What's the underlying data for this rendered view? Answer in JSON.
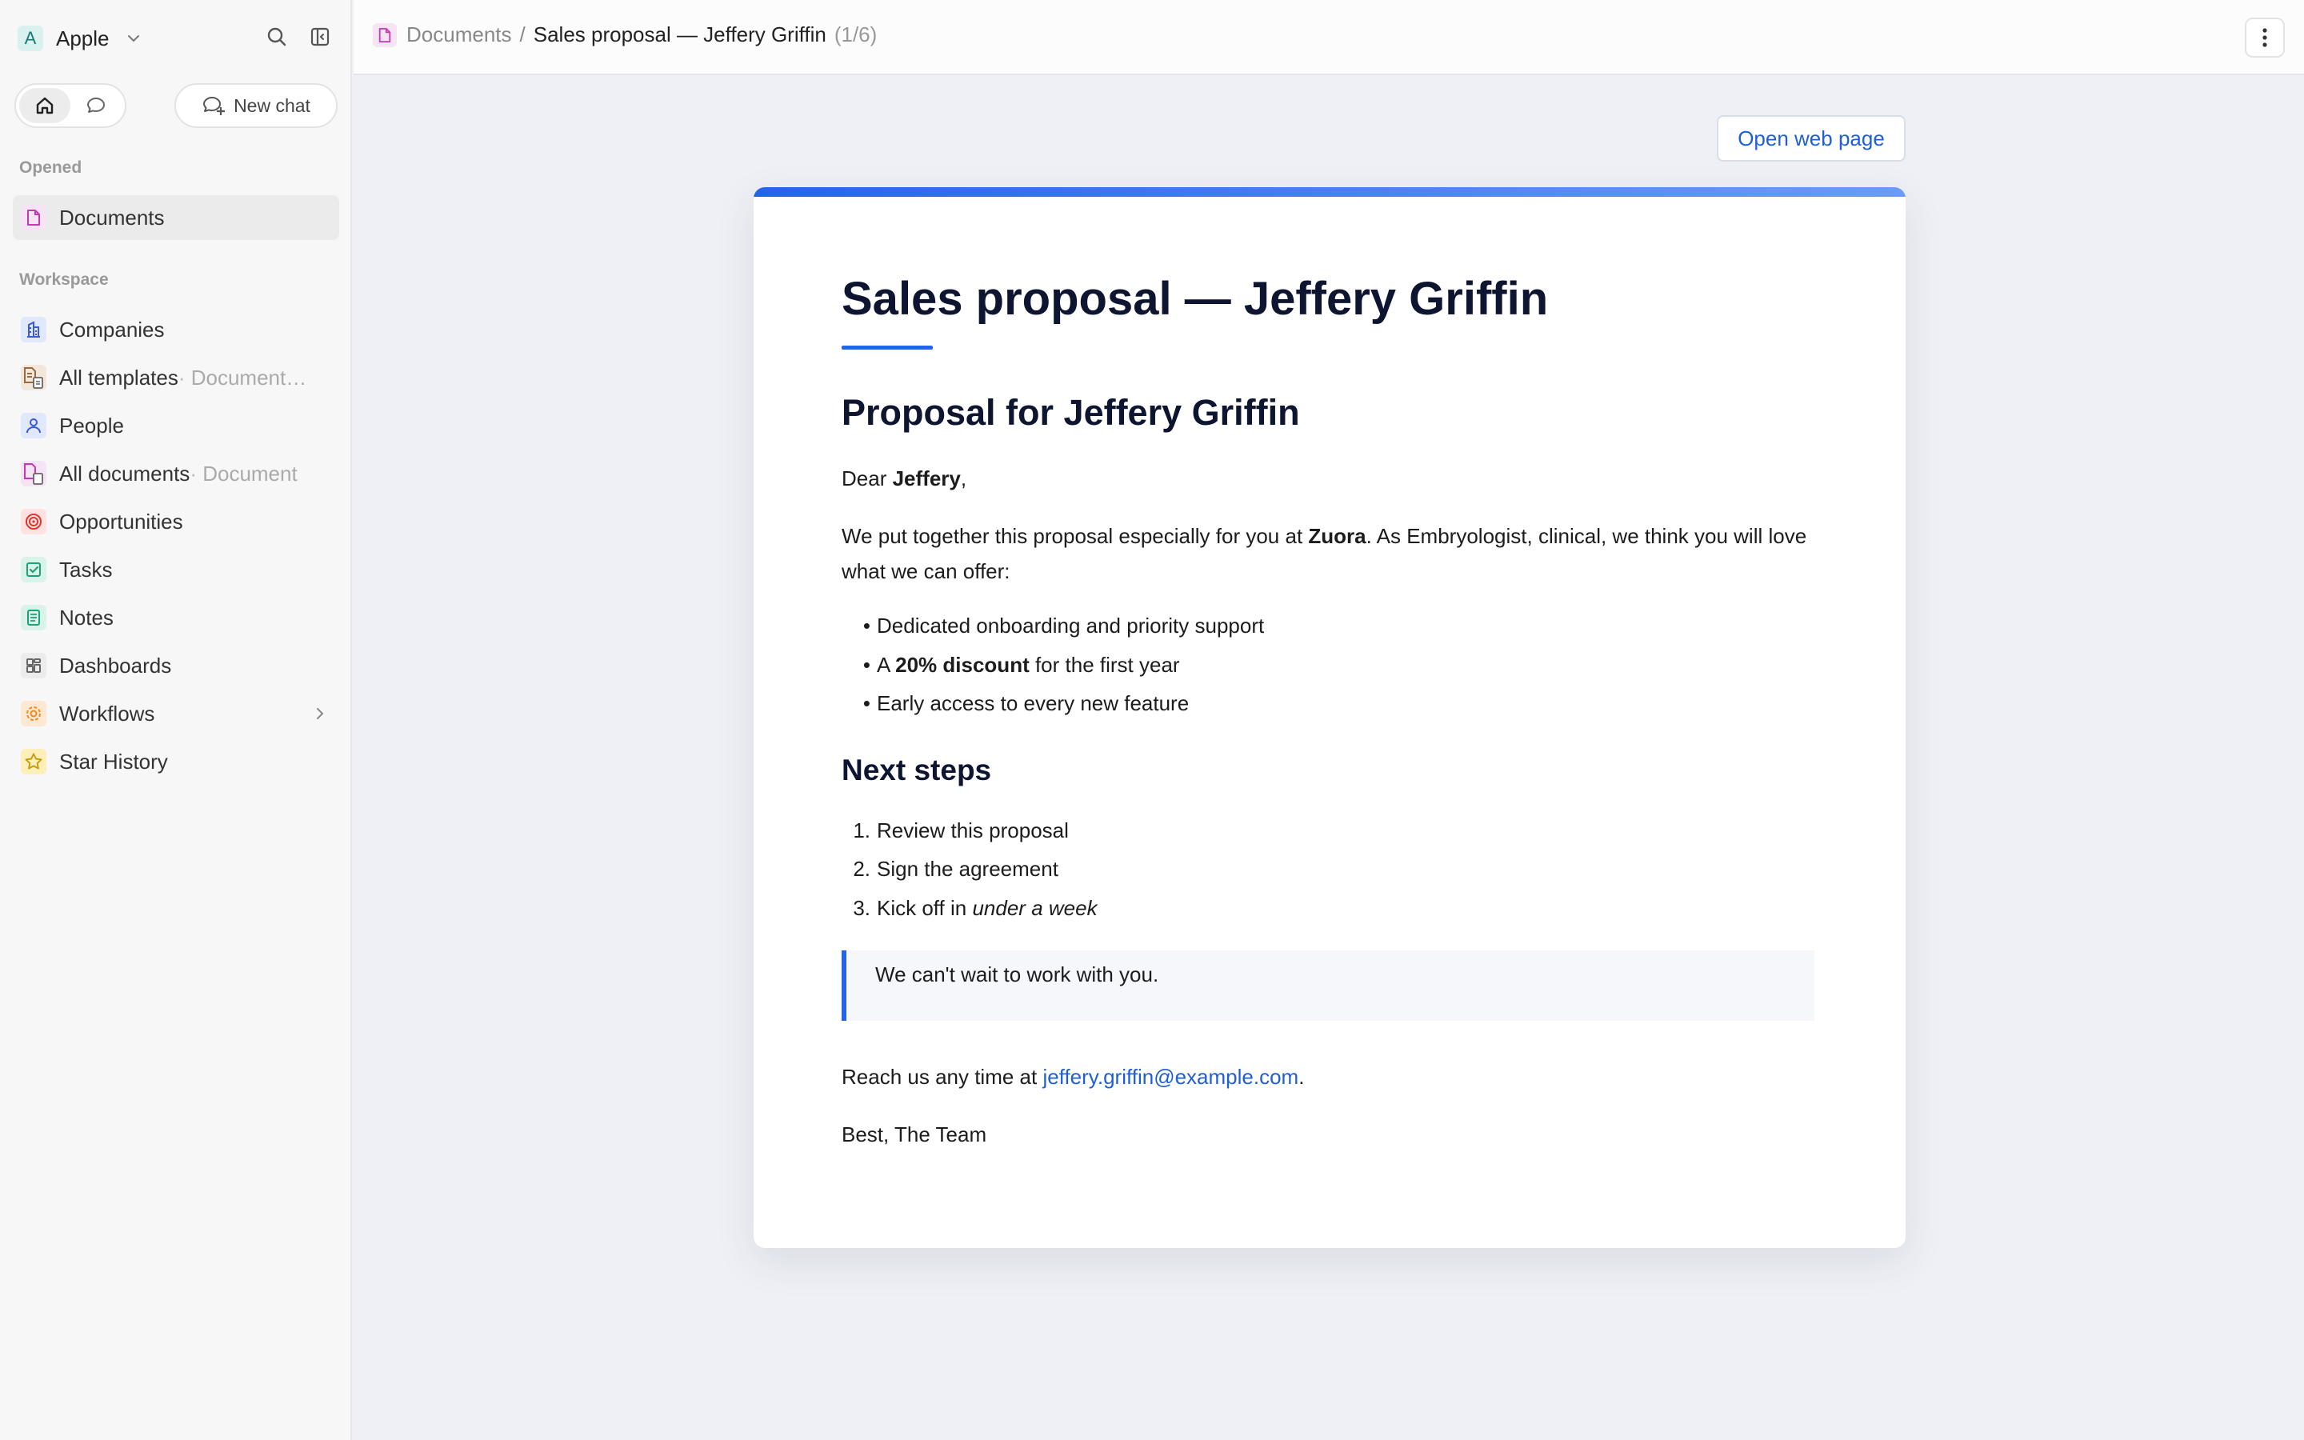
{
  "workspace": {
    "avatar_letter": "A",
    "name": "Apple"
  },
  "sidebar": {
    "new_chat_label": "New chat",
    "opened_label": "Opened",
    "opened_items": [
      {
        "label": "Documents",
        "icon": "document-icon",
        "color": "#c13bb5"
      }
    ],
    "workspace_label": "Workspace",
    "items": [
      {
        "label": "Companies",
        "icon": "building-icon",
        "color": "#3a5bd9"
      },
      {
        "label": "All templates",
        "sub": "Document t...",
        "icon": "templates-icon",
        "color": "#9a6a44"
      },
      {
        "label": "People",
        "icon": "person-icon",
        "color": "#3a5bd9"
      },
      {
        "label": "All documents",
        "sub": "Document",
        "icon": "documents-icon",
        "color": "#c13bb5"
      },
      {
        "label": "Opportunities",
        "icon": "target-icon",
        "color": "#e0362e"
      },
      {
        "label": "Tasks",
        "icon": "checkbox-icon",
        "color": "#1aa37a"
      },
      {
        "label": "Notes",
        "icon": "note-icon",
        "color": "#1aa37a"
      },
      {
        "label": "Dashboards",
        "icon": "dashboard-icon",
        "color": "#666666"
      },
      {
        "label": "Workflows",
        "icon": "gear-icon",
        "color": "#f08a1d"
      },
      {
        "label": "Star History",
        "icon": "star-icon",
        "color": "#e8b417"
      }
    ]
  },
  "header": {
    "breadcrumb_root": "Documents",
    "breadcrumb_sep": "/",
    "breadcrumb_current": "Sales proposal — Jeffery Griffin",
    "record_count": "(1/6)"
  },
  "main": {
    "open_web_label": "Open web page",
    "doc": {
      "title": "Sales proposal — Jeffery Griffin",
      "heading": "Proposal for Jeffery Griffin",
      "greeting_prefix": "Dear ",
      "greeting_name": "Jeffery",
      "greeting_suffix": ",",
      "intro_1": "We put together this proposal especially for you at ",
      "intro_company": "Zuora",
      "intro_2": ". As Embryologist, clinical, we think you will love what we can offer:",
      "bullets": {
        "b1": "Dedicated onboarding and priority support",
        "b2_pre": "A ",
        "b2_bold": "20% discount",
        "b2_post": " for the first year",
        "b3": "Early access to every new feature"
      },
      "next_steps_heading": "Next steps",
      "steps": {
        "s1": "Review this proposal",
        "s2": "Sign the agreement",
        "s3_pre": "Kick off in ",
        "s3_em": "under a week"
      },
      "quote": "We can't wait to work with you.",
      "contact_pre": "Reach us any time at ",
      "contact_email": "jeffery.griffin@example.com",
      "contact_post": ".",
      "signoff": "Best, The Team"
    }
  },
  "colors": {
    "accent": "#2563eb",
    "link": "#1f5fd6",
    "heading": "#0e1530"
  }
}
